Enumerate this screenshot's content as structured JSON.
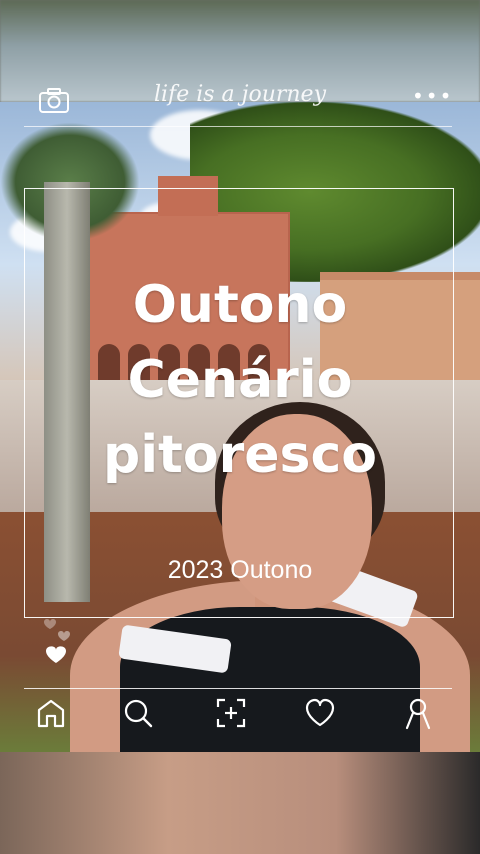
{
  "overlay": {
    "script_text": "life is a journey",
    "more_label": "•••",
    "title_lines": [
      "Outono",
      "Cenário",
      "pitoresco"
    ],
    "subtitle": "2023 Outono"
  },
  "nav": {
    "items": [
      {
        "icon": "home-icon"
      },
      {
        "icon": "search-icon"
      },
      {
        "icon": "add-photo-icon"
      },
      {
        "icon": "heart-icon"
      },
      {
        "icon": "profile-icon"
      }
    ]
  },
  "colors": {
    "overlay_text": "#ffffff",
    "frame_line": "#ffffff"
  }
}
